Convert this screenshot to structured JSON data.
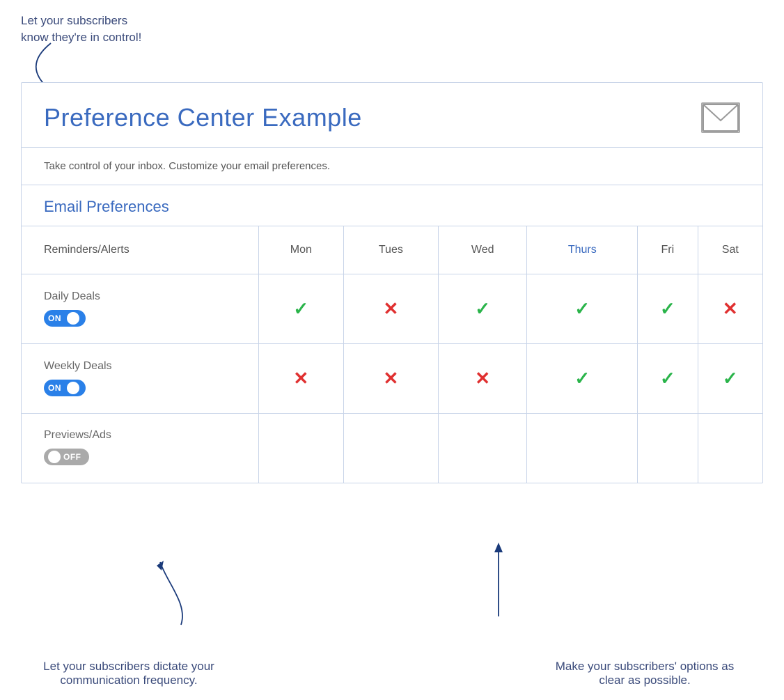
{
  "annotations": {
    "top_left_line1": "Let your subscribers",
    "top_left_line2": "know they're in control!",
    "bottom_left": "Let your subscribers dictate your communication frequency.",
    "bottom_right": "Make your subscribers' options as clear as possible."
  },
  "card": {
    "title": "Preference Center Example",
    "subtitle": "Take control of your inbox. Customize your email preferences.",
    "email_preferences_label": "Email Preferences"
  },
  "table": {
    "header_col": "Reminders/Alerts",
    "days": [
      "Mon",
      "Tues",
      "Wed",
      "Thurs",
      "Fri",
      "Sat"
    ],
    "rows": [
      {
        "label": "Daily Deals",
        "toggle": "ON",
        "toggle_state": "on",
        "values": [
          "check",
          "cross",
          "check",
          "check",
          "check",
          "cross"
        ]
      },
      {
        "label": "Weekly Deals",
        "toggle": "ON",
        "toggle_state": "on",
        "values": [
          "cross",
          "cross",
          "cross",
          "check",
          "check",
          "check"
        ]
      },
      {
        "label": "Previews/Ads",
        "toggle": "OFF",
        "toggle_state": "off",
        "values": [
          "",
          "",
          "",
          "",
          "",
          ""
        ]
      }
    ]
  }
}
